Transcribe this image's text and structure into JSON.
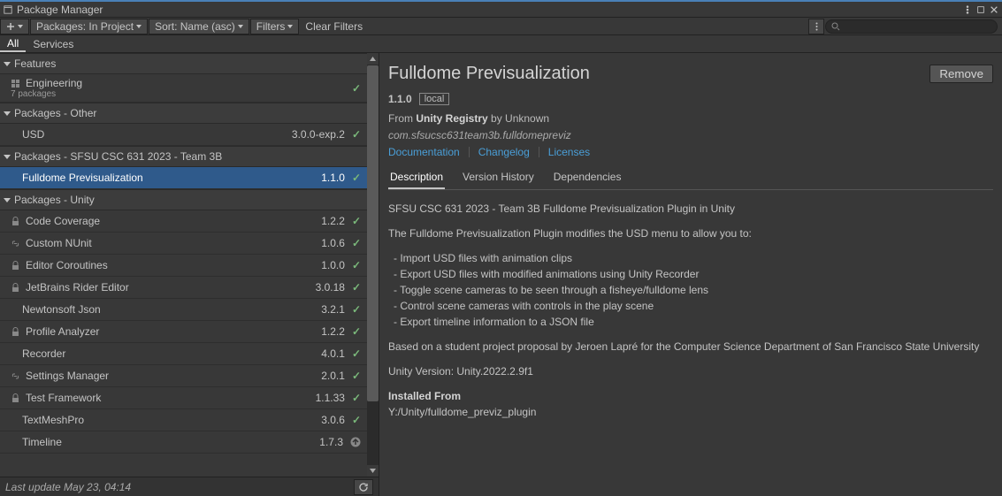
{
  "window": {
    "title": "Package Manager"
  },
  "toolbar": {
    "packages_dropdown": "Packages: In Project",
    "sort_dropdown": "Sort: Name (asc)",
    "filters_dropdown": "Filters",
    "clear_filters": "Clear Filters"
  },
  "top_tabs": {
    "all": "All",
    "services": "Services"
  },
  "sections": {
    "features": {
      "label": "Features",
      "subcategory": {
        "name": "Engineering",
        "count_label": "7 packages"
      }
    },
    "other": {
      "label": "Packages - Other"
    },
    "team3b": {
      "label": "Packages - SFSU CSC 631 2023 - Team 3B"
    },
    "unity": {
      "label": "Packages - Unity"
    }
  },
  "packages": {
    "usd": {
      "name": "USD",
      "version": "3.0.0-exp.2"
    },
    "fulldome": {
      "name": "Fulldome Previsualization",
      "version": "1.1.0"
    },
    "code_coverage": {
      "name": "Code Coverage",
      "version": "1.2.2"
    },
    "custom_nunit": {
      "name": "Custom NUnit",
      "version": "1.0.6"
    },
    "editor_coroutines": {
      "name": "Editor Coroutines",
      "version": "1.0.0"
    },
    "rider": {
      "name": "JetBrains Rider Editor",
      "version": "3.0.18"
    },
    "newtonsoft": {
      "name": "Newtonsoft Json",
      "version": "3.2.1"
    },
    "profile_analyzer": {
      "name": "Profile Analyzer",
      "version": "1.2.2"
    },
    "recorder": {
      "name": "Recorder",
      "version": "4.0.1"
    },
    "settings_mgr": {
      "name": "Settings Manager",
      "version": "2.0.1"
    },
    "test_framework": {
      "name": "Test Framework",
      "version": "1.1.33"
    },
    "textmeshpro": {
      "name": "TextMeshPro",
      "version": "3.0.6"
    },
    "timeline": {
      "name": "Timeline",
      "version": "1.7.3"
    }
  },
  "status": {
    "last_update": "Last update May 23, 04:14"
  },
  "detail": {
    "title": "Fulldome Previsualization",
    "remove_label": "Remove",
    "version": "1.1.0",
    "local_badge": "local",
    "from_prefix": "From ",
    "registry": "Unity Registry",
    "by_author": " by Unknown",
    "package_id": "com.sfsucsc631team3b.fulldomepreviz",
    "links": {
      "doc": "Documentation",
      "changelog": "Changelog",
      "licenses": "Licenses"
    },
    "tabs": {
      "description": "Description",
      "version_history": "Version History",
      "dependencies": "Dependencies"
    },
    "body": {
      "line1": "SFSU CSC 631 2023 - Team 3B Fulldome Previsualization Plugin in Unity",
      "line2": "The Fulldome Previsualization Plugin modifies the USD menu to allow you to:",
      "b1": "- Import USD files with animation clips",
      "b2": "- Export USD files with modified animations using Unity Recorder",
      "b3": "- Toggle scene cameras to be seen through a fisheye/fulldome lens",
      "b4": "- Control scene cameras with controls in the play scene",
      "b5": "- Export timeline information to a JSON file",
      "line3": "Based on a student project proposal by Jeroen Lapré for the Computer Science Department of San Francisco State University",
      "line4": "Unity Version: Unity.2022.2.9f1",
      "installed_from_label": "Installed From",
      "installed_path": "Y:/Unity/fulldome_previz_plugin"
    }
  }
}
